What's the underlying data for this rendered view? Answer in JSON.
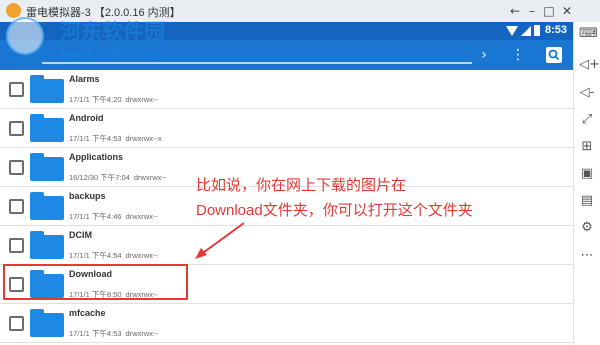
{
  "window": {
    "title": "雷电模拟器-3 【2.0.0.16 内测】",
    "controls": [
      "←",
      "–",
      "□",
      "✕"
    ]
  },
  "status_bar": {
    "time": "8:53"
  },
  "toolbar": {
    "forward_icon": "›",
    "more_icon": "⋮",
    "search_icon": "search-icon"
  },
  "watermark": {
    "title": "河东软件园",
    "url": "www.pc0359.cn"
  },
  "files": [
    {
      "name": "Alarms",
      "date": "17/1/1 下午4:20",
      "perm": "drwxrwx--"
    },
    {
      "name": "Android",
      "date": "17/1/1 下午4:53",
      "perm": "drwxrwx--x"
    },
    {
      "name": "Applications",
      "date": "16/12/30 下午7:04",
      "perm": "drwxrwx--"
    },
    {
      "name": "backups",
      "date": "17/1/1 下午4:46",
      "perm": "drwxrwx--"
    },
    {
      "name": "DCIM",
      "date": "17/1/1 下午4:54",
      "perm": "drwxrwx--"
    },
    {
      "name": "Download",
      "date": "17/1/1 下午8:50",
      "perm": "drwxrwx--"
    },
    {
      "name": "mfcache",
      "date": "17/1/1 下午4:53",
      "perm": "drwxrwx--"
    }
  ],
  "annotation": {
    "line1": "比如说，你在网上下载的图片在",
    "line2": "Download文件夹，你可以打开这个文件夹",
    "color": "#e53935"
  },
  "colors": {
    "status_bar": "#1565c0",
    "toolbar": "#1976d2",
    "folder": "#1e88e5"
  },
  "sidebar_icons": [
    "keyboard-icon",
    "volume-up-icon",
    "volume-down-icon",
    "fullscreen-icon",
    "add-icon",
    "screenshot-icon",
    "apk-icon",
    "settings-icon",
    "more-icon"
  ]
}
